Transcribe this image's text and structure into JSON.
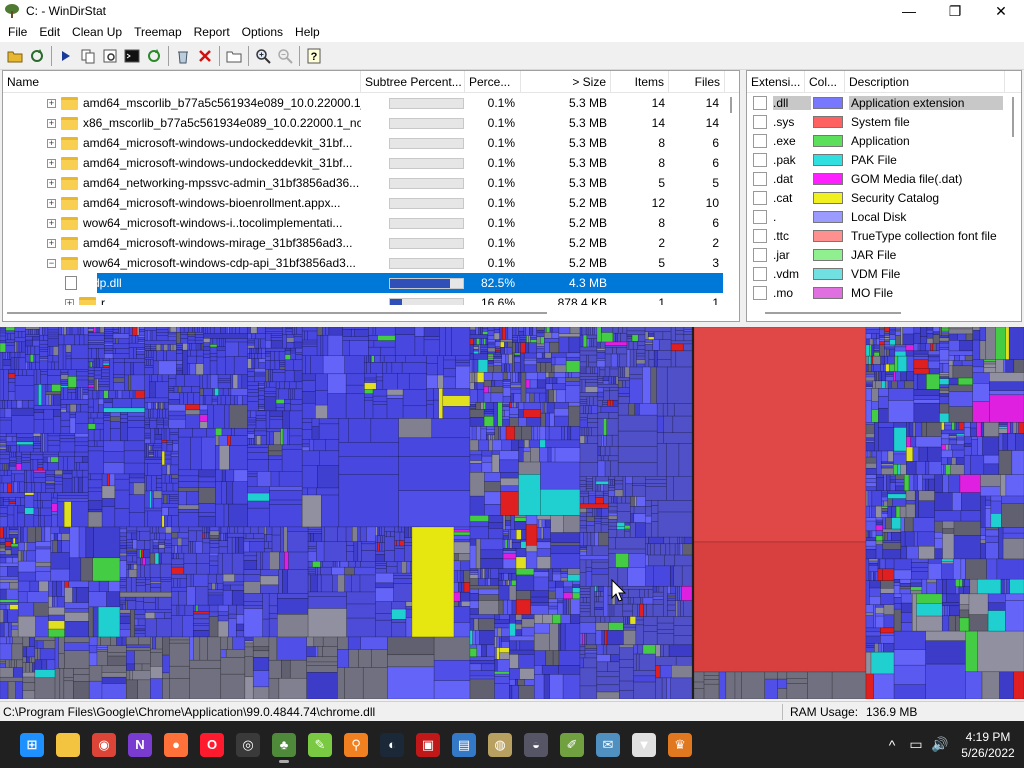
{
  "window": {
    "title": "C: - WinDirStat",
    "controls": {
      "minimize": "—",
      "maximize": "❐",
      "close": "✕"
    }
  },
  "menu": [
    "File",
    "Edit",
    "Clean Up",
    "Treemap",
    "Report",
    "Options",
    "Help"
  ],
  "toolbar_icons": [
    "open-icon",
    "refresh-all-icon",
    "play-icon",
    "copy-icon",
    "explorer-icon",
    "cmd-icon",
    "refresh-icon",
    "recycle-icon",
    "delete-icon",
    "new-folder-icon",
    "zoom-in-icon",
    "zoom-out-icon",
    "help-icon"
  ],
  "tree": {
    "columns": [
      "Name",
      "Subtree Percent...",
      "Perce...",
      "> Size",
      "Items",
      "Files"
    ],
    "rows": [
      {
        "name": "amd64_mscorlib_b77a5c561934e089_10.0.22000.1_...",
        "fill": 0.001,
        "percent": "0.1%",
        "size": "5.3 MB",
        "items": "14",
        "files": "14",
        "type": "folder",
        "expander": "+"
      },
      {
        "name": "x86_mscorlib_b77a5c561934e089_10.0.22000.1_no...",
        "fill": 0.001,
        "percent": "0.1%",
        "size": "5.3 MB",
        "items": "14",
        "files": "14",
        "type": "folder",
        "expander": "+"
      },
      {
        "name": "amd64_microsoft-windows-undockeddevkit_31bf...",
        "fill": 0.001,
        "percent": "0.1%",
        "size": "5.3 MB",
        "items": "8",
        "files": "6",
        "type": "folder",
        "expander": "+"
      },
      {
        "name": "amd64_microsoft-windows-undockeddevkit_31bf...",
        "fill": 0.001,
        "percent": "0.1%",
        "size": "5.3 MB",
        "items": "8",
        "files": "6",
        "type": "folder",
        "expander": "+"
      },
      {
        "name": "amd64_networking-mpssvc-admin_31bf3856ad36...",
        "fill": 0.001,
        "percent": "0.1%",
        "size": "5.3 MB",
        "items": "5",
        "files": "5",
        "type": "folder",
        "expander": "+"
      },
      {
        "name": "amd64_microsoft-windows-bioenrollment.appx...",
        "fill": 0.001,
        "percent": "0.1%",
        "size": "5.2 MB",
        "items": "12",
        "files": "10",
        "type": "folder",
        "expander": "+"
      },
      {
        "name": "wow64_microsoft-windows-i..tocolimplementati...",
        "fill": 0.001,
        "percent": "0.1%",
        "size": "5.2 MB",
        "items": "8",
        "files": "6",
        "type": "folder",
        "expander": "+"
      },
      {
        "name": "amd64_microsoft-windows-mirage_31bf3856ad3...",
        "fill": 0.001,
        "percent": "0.1%",
        "size": "5.2 MB",
        "items": "2",
        "files": "2",
        "type": "folder",
        "expander": "+"
      },
      {
        "name": "wow64_microsoft-windows-cdp-api_31bf3856ad3...",
        "fill": 0.001,
        "percent": "0.1%",
        "size": "5.2 MB",
        "items": "5",
        "files": "3",
        "type": "folder",
        "expander": "−"
      },
      {
        "name": "cdp.dll",
        "fill": 0.825,
        "percent": "82.5%",
        "size": "4.3 MB",
        "items": "",
        "files": "",
        "type": "file",
        "expander": "",
        "selected": true
      },
      {
        "name": "r",
        "fill": 0.166,
        "percent": "16.6%",
        "size": "878.4 KB",
        "items": "1",
        "files": "1",
        "type": "folder",
        "expander": "+"
      }
    ]
  },
  "extensions": {
    "columns": [
      "Extensi...",
      "Col...",
      "Description"
    ],
    "rows": [
      {
        "ext": ".dll",
        "color": "#7878ff",
        "desc": "Application extension",
        "icon": "dll-icon",
        "selected": true
      },
      {
        "ext": ".sys",
        "color": "#ff6060",
        "desc": "System file",
        "icon": "sys-icon"
      },
      {
        "ext": ".exe",
        "color": "#5ce05c",
        "desc": "Application",
        "icon": "exe-icon"
      },
      {
        "ext": ".pak",
        "color": "#30e0e0",
        "desc": "PAK File",
        "icon": "pak-icon"
      },
      {
        "ext": ".dat",
        "color": "#ff20ff",
        "desc": "GOM Media file(.dat)",
        "icon": "dat-icon"
      },
      {
        "ext": ".cat",
        "color": "#f0f020",
        "desc": "Security Catalog",
        "icon": "cat-icon"
      },
      {
        "ext": ".",
        "color": "#9a9aff",
        "desc": "Local Disk",
        "icon": "blank-icon"
      },
      {
        "ext": ".ttc",
        "color": "#ff9090",
        "desc": "TrueType collection font file",
        "icon": "ttc-icon"
      },
      {
        "ext": ".jar",
        "color": "#90f090",
        "desc": "JAR File",
        "icon": "jar-icon"
      },
      {
        "ext": ".vdm",
        "color": "#70e0e0",
        "desc": "VDM File",
        "icon": "vdm-icon"
      },
      {
        "ext": ".mo",
        "color": "#e070e0",
        "desc": "MO File",
        "icon": "mo-icon"
      }
    ]
  },
  "status": {
    "path": "C:\\Program Files\\Google\\Chrome\\Application\\99.0.4844.74\\chrome.dll",
    "ram_label": "RAM Usage:",
    "ram_value": "136.9 MB"
  },
  "taskbar": {
    "apps": [
      {
        "name": "windows-start-icon",
        "color": "#1e90ff",
        "glyph": "⊞"
      },
      {
        "name": "file-explorer-icon",
        "color": "#f2c440",
        "glyph": ""
      },
      {
        "name": "chrome-icon",
        "color": "#db4437",
        "glyph": "◉"
      },
      {
        "name": "notion-icon",
        "color": "#7a3cd0",
        "glyph": "N"
      },
      {
        "name": "firefox-icon",
        "color": "#ff7139",
        "glyph": "●"
      },
      {
        "name": "opera-icon",
        "color": "#ff1b2d",
        "glyph": "O"
      },
      {
        "name": "obs-icon",
        "color": "#3a3a3a",
        "glyph": "◎"
      },
      {
        "name": "windirstat-icon",
        "color": "#4e8a3a",
        "glyph": "♣",
        "active": true
      },
      {
        "name": "lasso-icon",
        "color": "#7ac943",
        "glyph": "✎"
      },
      {
        "name": "search-icon",
        "color": "#f08020",
        "glyph": "⚲"
      },
      {
        "name": "steam-icon",
        "color": "#1b2838",
        "glyph": "◐"
      },
      {
        "name": "cpuz-icon",
        "color": "#c01818",
        "glyph": "▣"
      },
      {
        "name": "remote-desktop-icon",
        "color": "#3478c8",
        "glyph": "▤"
      },
      {
        "name": "disc-icon",
        "color": "#b8a060",
        "glyph": "◍"
      },
      {
        "name": "driverhub-icon",
        "color": "#555566",
        "glyph": "◒"
      },
      {
        "name": "notepad-icon",
        "color": "#70a040",
        "glyph": "✐"
      },
      {
        "name": "mail-icon",
        "color": "#5090c0",
        "glyph": "✉"
      },
      {
        "name": "fox-icon",
        "color": "#e0e0e0",
        "glyph": "▼"
      },
      {
        "name": "crown-icon",
        "color": "#e07820",
        "glyph": "♛"
      }
    ],
    "tray": {
      "chevron": "^",
      "network_icon": "▭",
      "volume_icon": "🔊",
      "time": "4:19 PM",
      "date": "5/26/2022"
    }
  }
}
